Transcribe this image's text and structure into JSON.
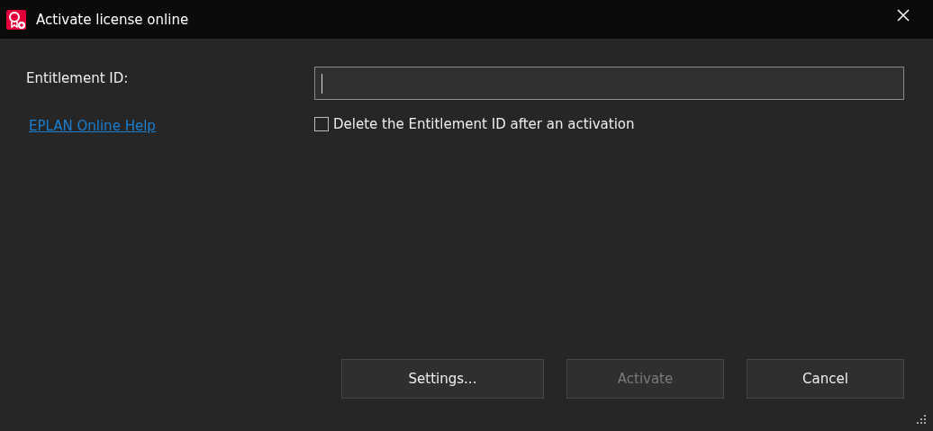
{
  "window": {
    "title": "Activate license online"
  },
  "field": {
    "label": "Entitlement ID:"
  },
  "help_link": "EPLAN Online Help",
  "checkbox": {
    "label": "Delete the Entitlement ID after an activation",
    "checked": false
  },
  "buttons": [
    {
      "label": "Settings...",
      "disabled": false
    },
    {
      "label": "Activate",
      "disabled": true
    },
    {
      "label": "Cancel",
      "disabled": false
    }
  ]
}
